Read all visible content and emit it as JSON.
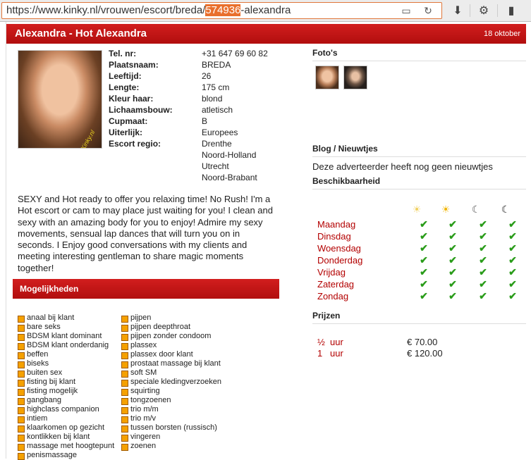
{
  "browser": {
    "url_prefix": "https://www.kinky.nl/vrouwen/escort/breda/",
    "url_selected": "574936",
    "url_suffix": "-alexandra"
  },
  "header": {
    "title": "Alexandra - Hot Alexandra",
    "date": "18 oktober"
  },
  "photo_watermark": "Kinky.nl",
  "profile": [
    {
      "k": "Tel. nr:",
      "v": "+31 647 69 60 82"
    },
    {
      "k": "Plaatsnaam:",
      "v": "BREDA"
    },
    {
      "k": "Leeftijd:",
      "v": "26"
    },
    {
      "k": "Lengte:",
      "v": "175 cm"
    },
    {
      "k": "Kleur haar:",
      "v": "blond"
    },
    {
      "k": "Lichaamsbouw:",
      "v": "atletisch"
    },
    {
      "k": "Cupmaat:",
      "v": "B"
    },
    {
      "k": "Uiterlijk:",
      "v": "Europees"
    },
    {
      "k": "Escort regio:",
      "v": "Drenthe"
    },
    {
      "k": "",
      "v": "Noord-Holland"
    },
    {
      "k": "",
      "v": "Utrecht"
    },
    {
      "k": "",
      "v": "Noord-Brabant"
    }
  ],
  "description": "SEXY and Hot ready to offer you relaxing time! No Rush! I'm a Hot escort or cam to may place just waiting for you! I clean and sexy with an amazing body for you to enjoy! Admire my sexy movements, sensual lap dances that will turn you on in seconds. I Enjoy good conversations with my clients and meeting interesting gentleman to share magic moments together!",
  "mogelijkheden": {
    "title": "Mogelijkheden",
    "col1": [
      "anaal bij klant",
      "bare seks",
      "BDSM klant dominant",
      "BDSM klant onderdanig",
      "beffen",
      "biseks",
      "buiten sex",
      "fisting bij klant",
      "fisting mogelijk",
      "gangbang",
      "highclass companion",
      "intiem",
      "klaarkomen op gezicht",
      "kontlikken bij klant",
      "massage met hoogtepunt",
      "penismassage"
    ],
    "col2": [
      "pijpen",
      "pijpen deepthroat",
      "pijpen zonder condoom",
      "plassex",
      "plassex door klant",
      "prostaat massage bij klant",
      "soft SM",
      "speciale kledingverzoeken",
      "squirting",
      "tongzoenen",
      "trio m/m",
      "trio m/v",
      "tussen borsten (russisch)",
      "vingeren",
      "zoenen"
    ]
  },
  "right": {
    "fotos_title": "Foto's",
    "blog_title": "Blog / Nieuwtjes",
    "blog_text": "Deze adverteerder heeft nog geen nieuwtjes",
    "availability_title": "Beschikbaarheid",
    "days": [
      "Maandag",
      "Dinsdag",
      "Woensdag",
      "Donderdag",
      "Vrijdag",
      "Zaterdag",
      "Zondag"
    ],
    "time_icons": [
      "sunrise-icon",
      "sun-icon",
      "moon-icon",
      "night-moon-icon"
    ],
    "check": "✔",
    "prices_title": "Prijzen",
    "prices": [
      {
        "qty": "½",
        "unit": "uur",
        "price": "€ 70.00"
      },
      {
        "qty": "1",
        "unit": "uur",
        "price": "€ 120.00"
      }
    ]
  },
  "colors": {
    "accent": "#c41414",
    "option_bullet": "#f5a100",
    "check": "#2a9c1a"
  }
}
